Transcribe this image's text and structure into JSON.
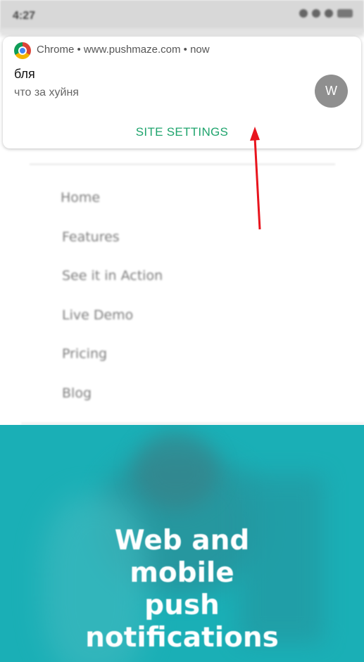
{
  "status_bar": {
    "time": "4:27",
    "signal_text": "..il ..il ≈ "
  },
  "notification": {
    "app_name": "Chrome",
    "header": "Chrome • www.pushmaze.com • now",
    "title": "бля",
    "body": "что за хуйня",
    "avatar_letter": "W",
    "action_label": "SITE SETTINGS",
    "action_color": "#1fa46d",
    "app_icon": "chrome-icon"
  },
  "site": {
    "nav_items": [
      "Home",
      "Features",
      "See it in Action",
      "Live Demo",
      "Pricing",
      "Blog"
    ],
    "hero_lines": [
      "Web and",
      "mobile",
      "push",
      "notifications"
    ],
    "hero_color": "#1aafb6"
  },
  "annotation": {
    "arrow_color": "#e8141d"
  }
}
